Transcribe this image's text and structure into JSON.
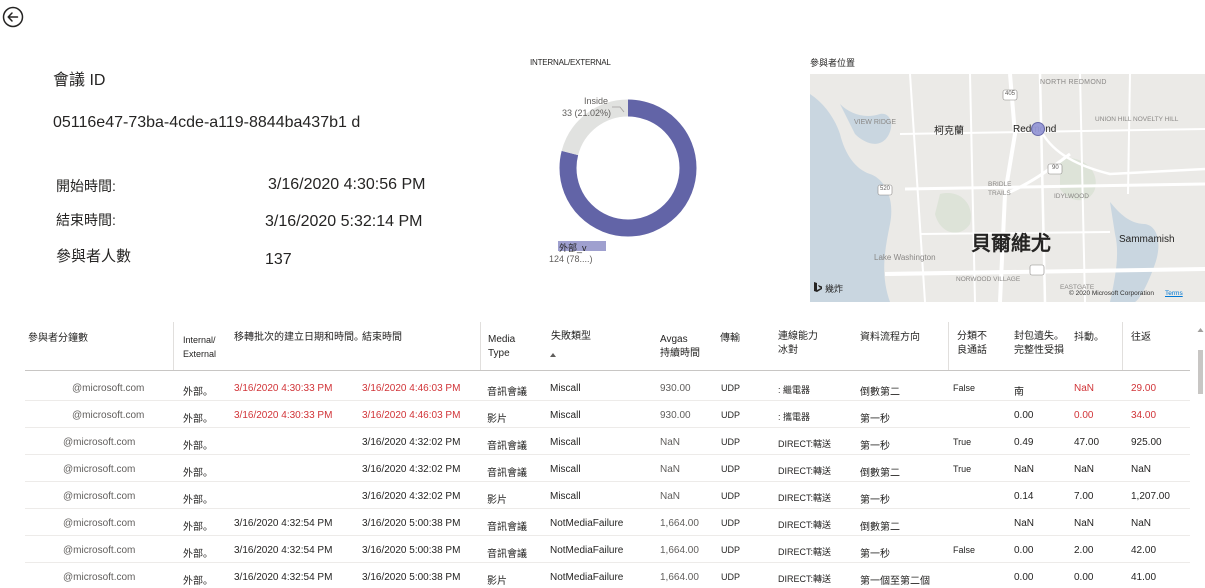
{
  "info": {
    "meeting_id_label": "會議 ID",
    "meeting_id_value": "05116e47-73ba-4cde-a119-8844ba437b1 d",
    "start_label": "開始時間:",
    "start_value": "3/16/2020 4:30:56 PM",
    "end_label": "結束時間:",
    "end_value": "3/16/2020 5:32:14 PM",
    "count_label": "參與者人數",
    "count_value": "137"
  },
  "donut": {
    "title": "INTERNAL/EXTERNAL",
    "inside_label": "Inside",
    "inside_value": "33 (21.02%)",
    "outside_label": "外部_v",
    "outside_value": "124 (78....)",
    "inside_fraction": 0.2102,
    "colors": {
      "inside": "#e1e2e0",
      "outside": "#6264a7"
    }
  },
  "map": {
    "title": "參與者位置",
    "labels": {
      "north_redmond": "NORTH REDMOND",
      "view_ridge": "VIEW RIDGE",
      "kirkland": "柯克蘭",
      "redmond": "Redmond",
      "union_hill": "UNION HILL NOVELTY HILL",
      "bridle_trails": "BRIDLE TRAILS",
      "idylwood": "IDYLWOOD",
      "bellevue": "貝爾維尤",
      "sammamish": "Sammamish",
      "lake_washington": "Lake Washington",
      "norwood_village": "NORWOOD VILLAGE",
      "eastgate": "EASTGATE",
      "highway_405": "405",
      "highway_520": "520",
      "highway_90": "90"
    },
    "bing_label": "幾炸",
    "copyright": "© 2020 Microsoft Corporation",
    "terms": "Terms"
  },
  "table": {
    "headers": {
      "participant": "參與者分鐘數",
      "internal": "Internal/\nExternal",
      "created": "移轉批次的建立日期和時間。",
      "end": "結束時間",
      "media": "Media\nType",
      "failure": "失敗類型",
      "avg": "Avgas\n持續時間",
      "transport": "傳輸",
      "connectivity": "連線能力\n冰對",
      "stream": "資料流程方向",
      "classify": "分類不\n良通話",
      "packet": "封包遺失。\n完整性受損",
      "jitter": "抖動。",
      "rtt": "往返"
    },
    "rows": [
      {
        "participant": "@microsoft.com",
        "internal": "外部。",
        "created": "3/16/2020 4:30:33 PM",
        "end": "3/16/2020 4:46:03 PM",
        "media": "音訊會議",
        "failure": "Miscall",
        "avg": "930.00",
        "transport": "UDP",
        "connectivity": ": 繼電器",
        "stream": "倒數第二",
        "classify": "False",
        "packet": "南",
        "jitter": "NaN",
        "rtt": "29.00"
      },
      {
        "participant": "@microsoft.com",
        "internal": "外部。",
        "created": "3/16/2020 4:30:33 PM",
        "end": "3/16/2020 4:46:03 PM",
        "media": "影片",
        "failure": "Miscall",
        "avg": "930.00",
        "transport": "UDP",
        "connectivity": ": 攜電器",
        "stream": "第一秒",
        "classify": "",
        "packet": "0.00",
        "jitter": "0.00",
        "rtt": "34.00"
      },
      {
        "participant": "@microsoft.com",
        "internal": "外部。",
        "created": "",
        "end": "3/16/2020 4:32:02 PM",
        "media": "音訊會議",
        "failure": "Miscall",
        "avg": "NaN",
        "transport": "UDP",
        "connectivity": "DIRECT:轄送",
        "stream": "第一秒",
        "classify": "True",
        "packet": "0.49",
        "jitter": "47.00",
        "rtt": "925.00"
      },
      {
        "participant": "@microsoft.com",
        "internal": "外部。",
        "created": "",
        "end": "3/16/2020 4:32:02 PM",
        "media": "音訊會議",
        "failure": "Miscall",
        "avg": "NaN",
        "transport": "UDP",
        "connectivity": "DIRECT:轉送",
        "stream": "倒數第二",
        "classify": "True",
        "packet": "NaN",
        "jitter": "NaN",
        "rtt": "NaN"
      },
      {
        "participant": "@microsoft.com",
        "internal": "外部。",
        "created": "",
        "end": "3/16/2020 4:32:02 PM",
        "media": "影片",
        "failure": "Miscall",
        "avg": "NaN",
        "transport": "UDP",
        "connectivity": "DIRECT:轄送",
        "stream": "第一秒",
        "classify": "",
        "packet": "0.14",
        "jitter": "7.00",
        "rtt": "1,207.00"
      },
      {
        "participant": "@microsoft.com",
        "internal": "外部。",
        "created": "3/16/2020 4:32:54 PM",
        "end": "3/16/2020 5:00:38 PM",
        "media": "音訊會議",
        "failure": "NotMediaFailure",
        "avg": "1,664.00",
        "transport": "UDP",
        "connectivity": "DIRECT:轉送",
        "stream": "倒數第二",
        "classify": "",
        "packet": "NaN",
        "jitter": "NaN",
        "rtt": "NaN"
      },
      {
        "participant": "@microsoft.com",
        "internal": "外部。",
        "created": "3/16/2020 4:32:54 PM",
        "end": "3/16/2020 5:00:38 PM",
        "media": "音訊會議",
        "failure": "NotMediaFailure",
        "avg": "1,664.00",
        "transport": "UDP",
        "connectivity": "DIRECT:轄送",
        "stream": "第一秒",
        "classify": "False",
        "packet": "0.00",
        "jitter": "2.00",
        "rtt": "42.00"
      },
      {
        "participant": "@microsoft.com",
        "internal": "外部。",
        "created": "3/16/2020 4:32:54 PM",
        "end": "3/16/2020 5:00:38 PM",
        "media": "影片",
        "failure": "NotMediaFailure",
        "avg": "1,664.00",
        "transport": "UDP",
        "connectivity": "DIRECT:轉送",
        "stream": "第一個至第二個",
        "classify": "",
        "packet": "0.00",
        "jitter": "0.00",
        "rtt": "41.00"
      }
    ],
    "red_rows": [
      0,
      1
    ]
  }
}
